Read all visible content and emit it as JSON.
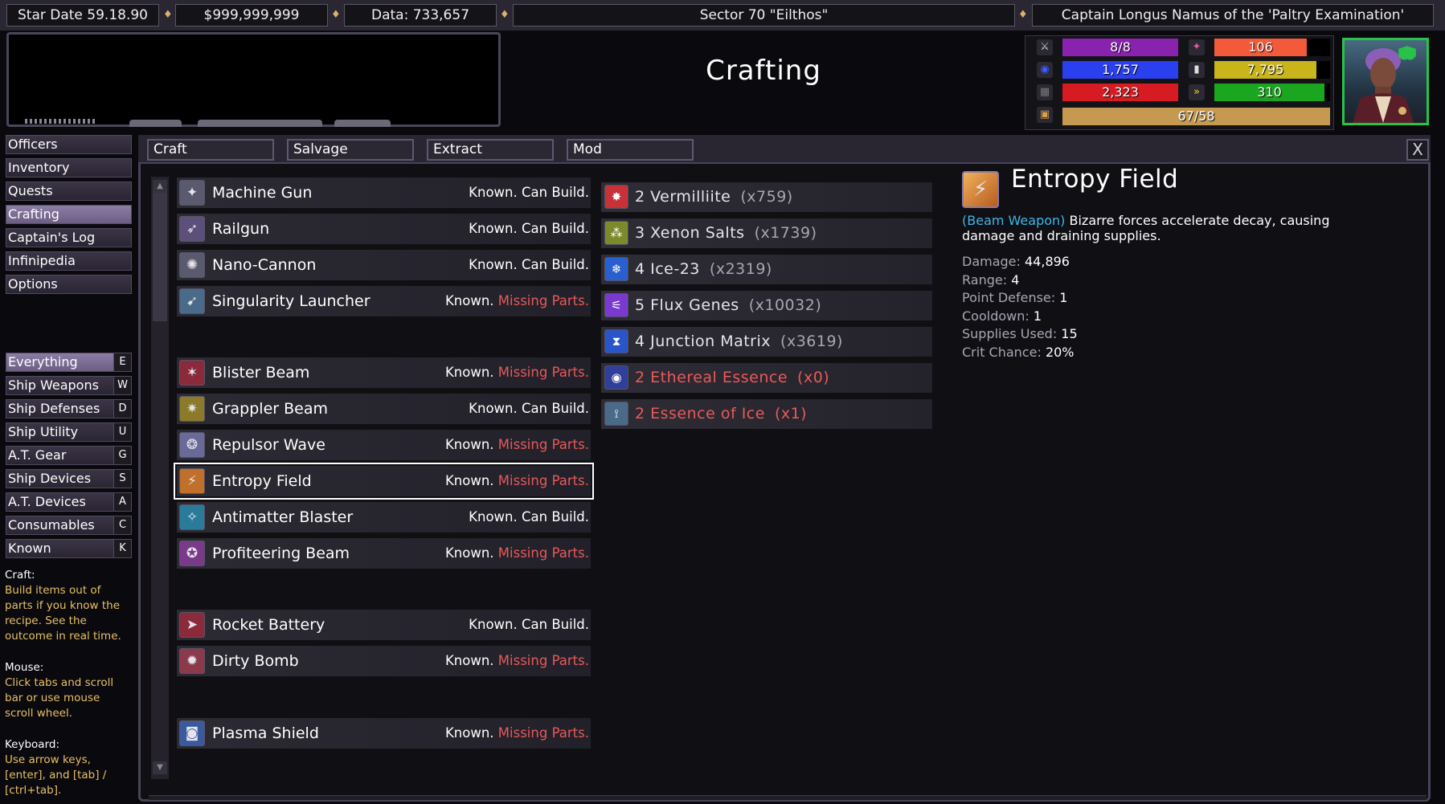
{
  "topbar": {
    "star_date": "Star Date 59.18.90",
    "credits": "$999,999,999",
    "data": "Data: 733,657",
    "sector": "Sector 70 \"Eilthos\"",
    "captain": "Captain Longus Namus of the 'Paltry Examination'"
  },
  "header": {
    "title": "Crafting"
  },
  "stats": [
    {
      "icon": "ship-icon",
      "value": "8/8",
      "fill": 1.0,
      "color": "#8a22b0"
    },
    {
      "icon": "shield-icon",
      "value": "1,757",
      "fill": 1.0,
      "color": "#2a3ff0"
    },
    {
      "icon": "armor-icon",
      "value": "2,323",
      "fill": 1.0,
      "color": "#d61b22"
    },
    {
      "icon": "stat-icon-a",
      "value": "106",
      "fill": 0.8,
      "color": "#f25a3a"
    },
    {
      "icon": "stat-icon-b",
      "value": "7,795",
      "fill": 0.88,
      "color": "#c9b41c"
    },
    {
      "icon": "fuel-icon",
      "value": "310",
      "fill": 0.95,
      "color": "#1aa61e"
    },
    {
      "icon": "cargo-icon",
      "value": "67/58",
      "fill": 1.0,
      "color": "#c59a50"
    }
  ],
  "nav": {
    "items": [
      {
        "label": "Officers"
      },
      {
        "label": "Inventory"
      },
      {
        "label": "Quests"
      },
      {
        "label": "Crafting",
        "active": true
      },
      {
        "label": "Captain's Log"
      },
      {
        "label": "Infinipedia"
      },
      {
        "label": "Options"
      }
    ],
    "filters": [
      {
        "label": "Everything",
        "key": "E",
        "active": true
      },
      {
        "label": "Ship Weapons",
        "key": "W"
      },
      {
        "label": "Ship Defenses",
        "key": "D"
      },
      {
        "label": "Ship Utility",
        "key": "U"
      },
      {
        "label": "A.T. Gear",
        "key": "G"
      },
      {
        "label": "Ship Devices",
        "key": "S"
      },
      {
        "label": "A.T. Devices",
        "key": "A"
      },
      {
        "label": "Consumables",
        "key": "C"
      },
      {
        "label": "Known",
        "key": "K"
      }
    ]
  },
  "help": {
    "craft_title": "Craft:",
    "craft_text": "Build items out of parts if you know the recipe. See the outcome in real time.",
    "mouse_title": "Mouse:",
    "mouse_text": "Click tabs and scroll bar or use mouse scroll wheel.",
    "keyboard_title": "Keyboard:",
    "keyboard_text": "Use arrow keys, [enter], and [tab] / [ctrl+tab]."
  },
  "tabs": [
    "Craft",
    "Salvage",
    "Extract",
    "Mod"
  ],
  "close_label": "X",
  "recipes": [
    {
      "name": "Machine Gun",
      "known": "Known.",
      "status": "Can Build.",
      "ok": true,
      "icon": "gun-icon"
    },
    {
      "name": "Railgun",
      "known": "Known.",
      "status": "Can Build.",
      "ok": true,
      "icon": "railgun-icon"
    },
    {
      "name": "Nano-Cannon",
      "known": "Known.",
      "status": "Can Build.",
      "ok": true,
      "icon": "cannon-icon"
    },
    {
      "name": "Singularity Launcher",
      "known": "Known.",
      "status": "Missing Parts.",
      "ok": false,
      "icon": "launcher-icon"
    },
    {
      "name": "Blister Beam",
      "known": "Known.",
      "status": "Missing Parts.",
      "ok": false,
      "icon": "beam-icon"
    },
    {
      "name": "Grappler Beam",
      "known": "Known.",
      "status": "Can Build.",
      "ok": true,
      "icon": "grapple-icon"
    },
    {
      "name": "Repulsor Wave",
      "known": "Known.",
      "status": "Missing Parts.",
      "ok": false,
      "icon": "wave-icon"
    },
    {
      "name": "Entropy Field",
      "known": "Known.",
      "status": "Missing Parts.",
      "ok": false,
      "icon": "entropy-icon",
      "selected": true
    },
    {
      "name": "Antimatter Blaster",
      "known": "Known.",
      "status": "Can Build.",
      "ok": true,
      "icon": "blaster-icon"
    },
    {
      "name": "Profiteering Beam",
      "known": "Known.",
      "status": "Missing Parts.",
      "ok": false,
      "icon": "profit-beam-icon"
    },
    {
      "name": "Rocket Battery",
      "known": "Known.",
      "status": "Can Build.",
      "ok": true,
      "icon": "rocket-icon"
    },
    {
      "name": "Dirty Bomb",
      "known": "Known.",
      "status": "Missing Parts.",
      "ok": false,
      "icon": "bomb-icon"
    },
    {
      "name": "Plasma Shield",
      "known": "Known.",
      "status": "Missing Parts.",
      "ok": false,
      "icon": "plasma-shield-icon"
    }
  ],
  "parts": [
    {
      "text": "2 Vermilliite",
      "count": "(x759)",
      "missing": false,
      "icon": "mineral-icon",
      "color": "#c8303a"
    },
    {
      "text": "3 Xenon Salts",
      "count": "(x1739)",
      "missing": false,
      "icon": "salts-icon",
      "color": "#7c8a2c"
    },
    {
      "text": "4 Ice-23",
      "count": "(x2319)",
      "missing": false,
      "icon": "ice-icon",
      "color": "#2a5fd0"
    },
    {
      "text": "5 Flux Genes",
      "count": "(x10032)",
      "missing": false,
      "icon": "genes-icon",
      "color": "#7a3ad0"
    },
    {
      "text": "4 Junction Matrix",
      "count": "(x3619)",
      "missing": false,
      "icon": "matrix-icon",
      "color": "#2a55c8"
    },
    {
      "text": "2 Ethereal Essence",
      "count": "(x0)",
      "missing": true,
      "icon": "essence-icon",
      "color": "#2f3f9a"
    },
    {
      "text": "2 Essence of Ice",
      "count": "(x1)",
      "missing": true,
      "icon": "ice-essence-icon",
      "color": "#4a6a8a"
    }
  ],
  "detail": {
    "title": "Entropy Field",
    "type": "(Beam Weapon)",
    "description": "Bizarre forces accelerate decay, causing damage and draining supplies.",
    "stats": [
      {
        "label": "Damage:",
        "value": "44,896"
      },
      {
        "label": "Range:",
        "value": "4"
      },
      {
        "label": "Point Defense:",
        "value": "1"
      },
      {
        "label": "Cooldown:",
        "value": "1"
      },
      {
        "label": "Supplies Used:",
        "value": "15"
      },
      {
        "label": "Crit Chance:",
        "value": "20%"
      }
    ]
  }
}
